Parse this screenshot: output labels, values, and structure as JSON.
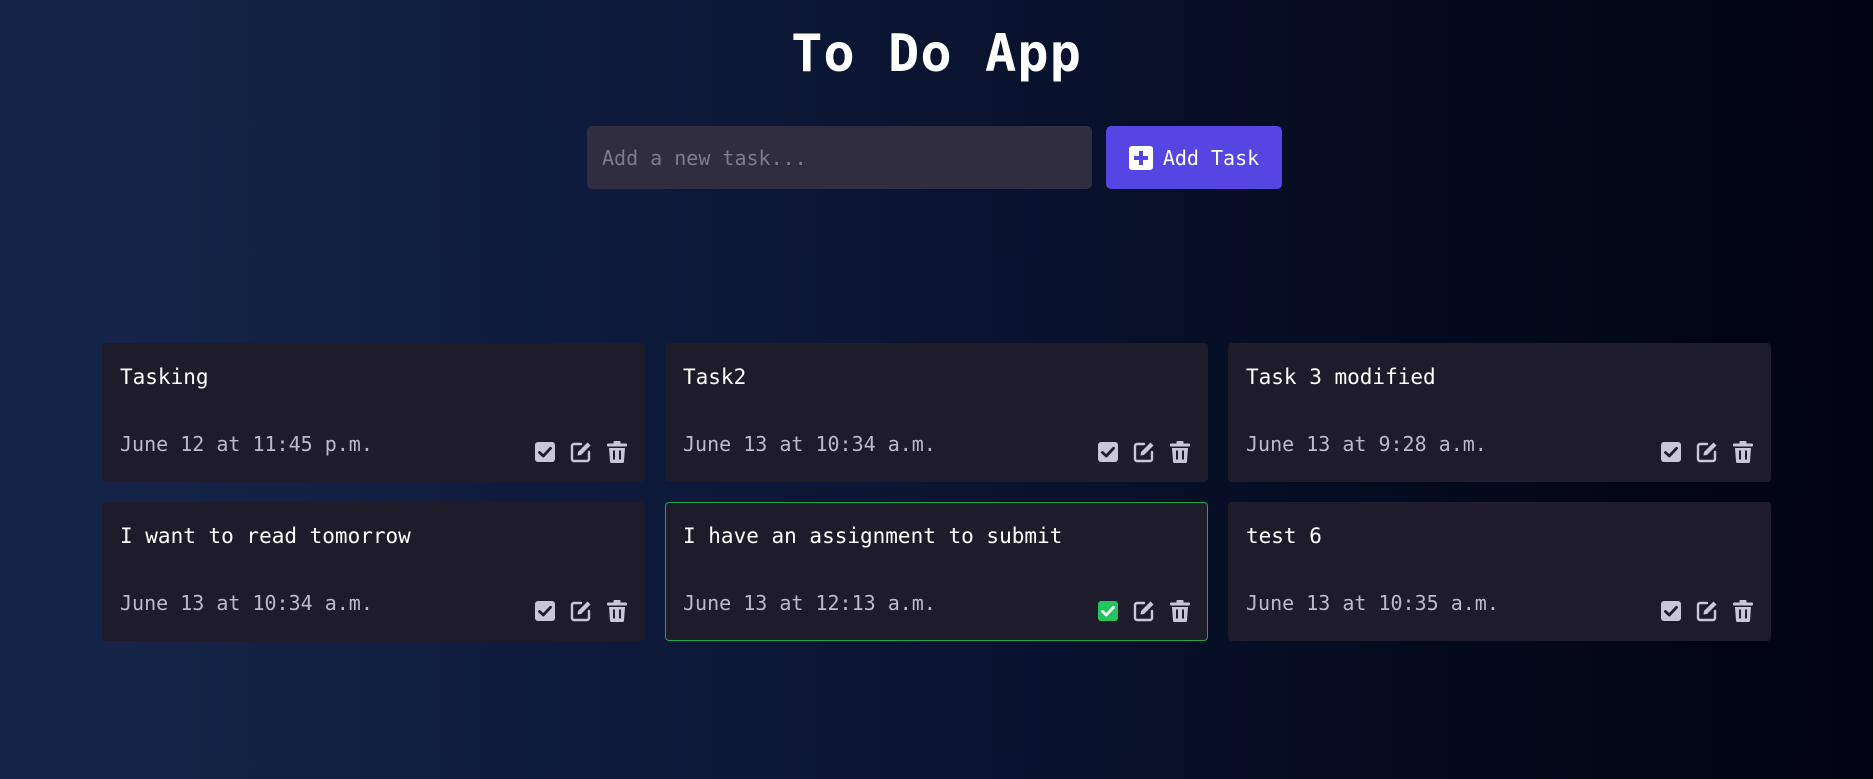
{
  "app": {
    "title": "To Do App"
  },
  "add_form": {
    "placeholder": "Add a new task...",
    "value": "",
    "button_label": "Add Task",
    "button_icon": "plus-square-icon",
    "button_color": "#5545e3"
  },
  "colors": {
    "card_background": "#1e1c2b",
    "completed_border": "#1fa451",
    "completed_check": "#22c55e",
    "icon_default": "#c9c7d3"
  },
  "tasks": [
    {
      "title": "Tasking",
      "date": "June 12 at 11:45 p.m.",
      "completed": false
    },
    {
      "title": "Task2",
      "date": "June 13 at 10:34 a.m.",
      "completed": false
    },
    {
      "title": "Task 3 modified",
      "date": "June 13 at 9:28 a.m.",
      "completed": false
    },
    {
      "title": "I want to read tomorrow",
      "date": "June 13 at 10:34 a.m.",
      "completed": false
    },
    {
      "title": "I have an assignment to submit",
      "date": "June 13 at 12:13 a.m.",
      "completed": true
    },
    {
      "title": "test 6",
      "date": "June 13 at 10:35 a.m.",
      "completed": false
    }
  ],
  "task_actions": [
    "checkbox-icon",
    "edit-icon",
    "trash-icon"
  ]
}
